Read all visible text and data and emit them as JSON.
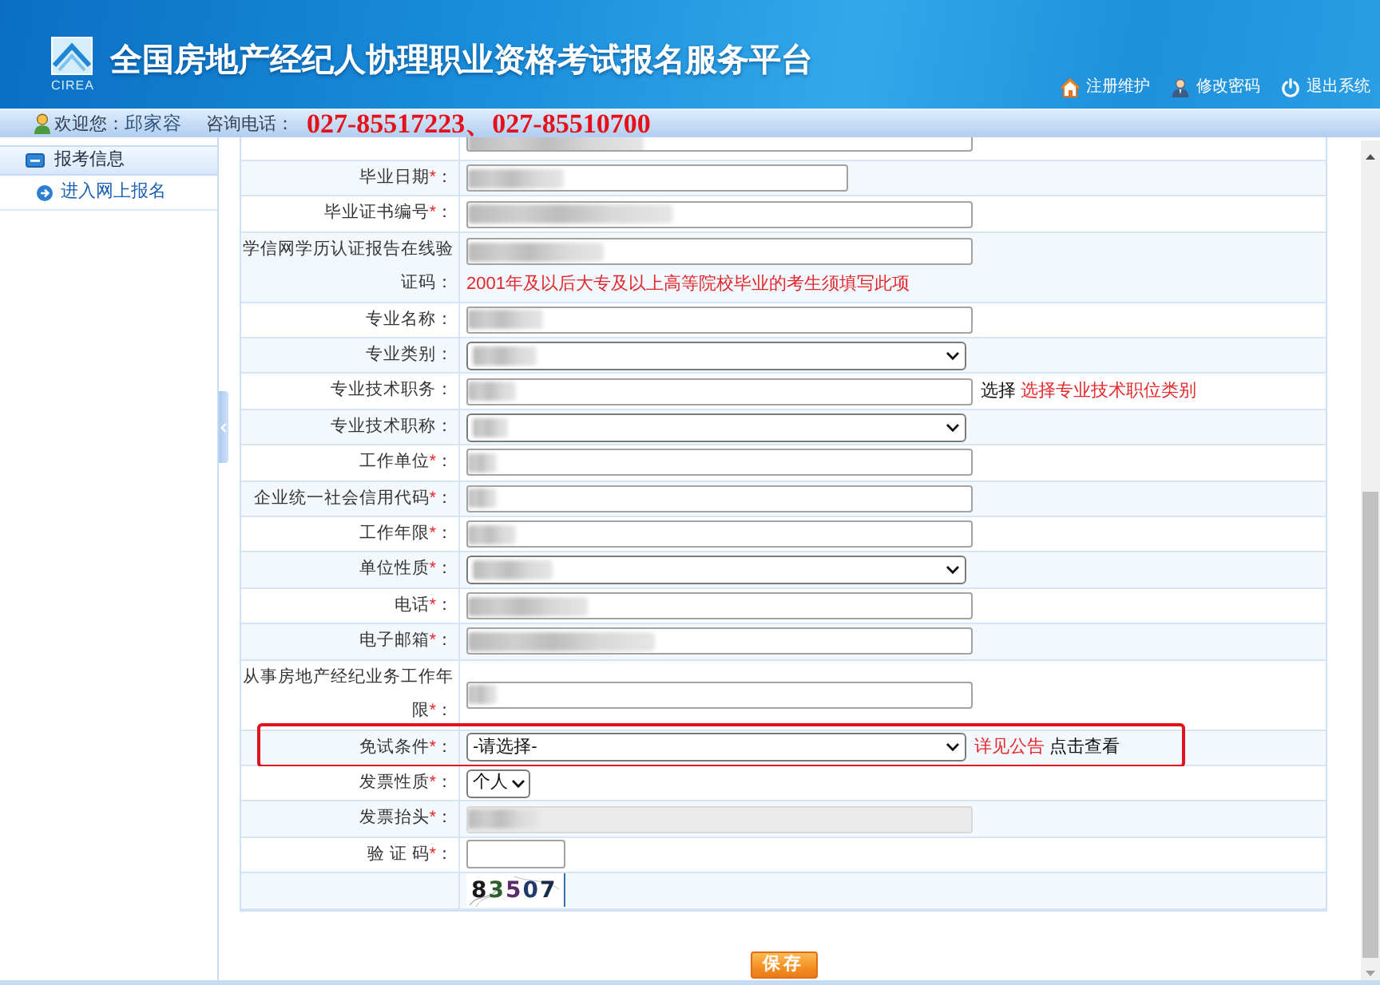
{
  "header": {
    "logo_text": "CIREA",
    "title": "全国房地产经纪人协理职业资格考试报名服务平台",
    "links": [
      "注册维护",
      "修改密码",
      "退出系统"
    ]
  },
  "info_bar": {
    "welcome_label": "欢迎您：",
    "user_name": "邱家容",
    "hotline_label": "咨询电话：",
    "hotline": "027-85517223、027-85510700"
  },
  "sidebar": {
    "section": "报考信息",
    "items": [
      {
        "label": "进入网上报名"
      }
    ]
  },
  "form": {
    "rows": [
      {
        "kind": "partial_text",
        "redacted": true,
        "disabled": false,
        "highlighted": false
      },
      {
        "label": "毕业日期",
        "asterisk": "*",
        "colon": "：",
        "kind": "date",
        "redacted": true,
        "disabled": false,
        "highlighted": false
      },
      {
        "label": "毕业证书编号",
        "asterisk": "*",
        "colon": "：",
        "kind": "text",
        "redacted": true,
        "disabled": false,
        "highlighted": false
      },
      {
        "label": "学信网学历认证报告在线验证码",
        "colon": "：",
        "kind": "text",
        "redacted": true,
        "disabled": false,
        "note": "2001年及以后大专及以上高等院校毕业的考生须填写此项",
        "highlighted": false
      },
      {
        "label": "专业名称",
        "colon": "：",
        "kind": "text",
        "redacted": true,
        "disabled": false,
        "highlighted": false
      },
      {
        "label": "专业类别",
        "colon": "：",
        "kind": "select",
        "redacted": true,
        "disabled": false,
        "highlighted": false
      },
      {
        "label": "专业技术职务",
        "colon": "：",
        "kind": "text",
        "redacted": true,
        "disabled": false,
        "extras": [
          {
            "kind": "text",
            "text": "选择"
          },
          {
            "kind": "link",
            "text": "选择专业技术职位类别"
          }
        ],
        "highlighted": false
      },
      {
        "label": "专业技术职称",
        "colon": "：",
        "kind": "select",
        "redacted": true,
        "disabled": false,
        "highlighted": false
      },
      {
        "label": "工作单位",
        "asterisk": "*",
        "colon": "：",
        "kind": "text",
        "redacted": true,
        "disabled": false,
        "highlighted": false
      },
      {
        "label": "企业统一社会信用代码",
        "asterisk": "*",
        "colon": "：",
        "kind": "text",
        "redacted": true,
        "disabled": false,
        "highlighted": false
      },
      {
        "label": "工作年限",
        "asterisk": "*",
        "colon": "：",
        "kind": "text",
        "redacted": true,
        "disabled": false,
        "highlighted": false
      },
      {
        "label": "单位性质",
        "asterisk": "*",
        "colon": "：",
        "kind": "select",
        "redacted": true,
        "disabled": false,
        "highlighted": false
      },
      {
        "label": "电话",
        "asterisk": "*",
        "colon": "：",
        "kind": "text",
        "redacted": true,
        "disabled": false,
        "highlighted": false
      },
      {
        "label": "电子邮箱",
        "asterisk": "*",
        "colon": "：",
        "kind": "text",
        "redacted": true,
        "disabled": false,
        "highlighted": false
      },
      {
        "label": "从事房地产经纪业务工作年限",
        "asterisk": "*",
        "colon": "：",
        "kind": "text",
        "redacted": true,
        "disabled": false,
        "highlighted": false
      },
      {
        "label": "免试条件",
        "asterisk": "*",
        "colon": "：",
        "kind": "select",
        "value": "-请选择-",
        "redacted": false,
        "disabled": false,
        "extras": [
          {
            "kind": "link",
            "text": "详见公告"
          },
          {
            "kind": "text",
            "text": "点击查看"
          }
        ],
        "highlighted": true
      },
      {
        "label": "发票性质",
        "asterisk": "*",
        "colon": "：",
        "kind": "short_select",
        "value": "个人",
        "redacted": false,
        "disabled": false,
        "highlighted": false
      },
      {
        "label": "发票抬头",
        "asterisk": "*",
        "colon": "：",
        "kind": "text",
        "redacted": true,
        "disabled": true,
        "highlighted": false
      },
      {
        "label": "验 证 码",
        "asterisk": "*",
        "colon": "：",
        "kind": "short_text",
        "redacted": false,
        "disabled": false,
        "highlighted": false
      },
      {
        "kind": "captcha_image",
        "captcha": "83507",
        "highlighted": false
      }
    ]
  },
  "save_button": "保存"
}
